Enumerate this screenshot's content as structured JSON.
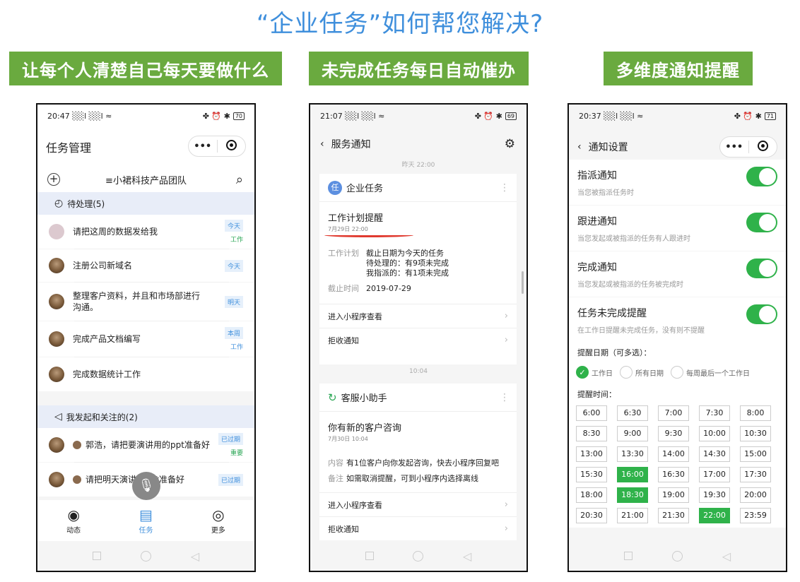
{
  "title": "“企业任务”如何帮您解决?",
  "banners": [
    "让每个人清楚自己每天要做什么",
    "未完成任务每日自动催办",
    "多维度通知提醒"
  ],
  "phone1": {
    "status": {
      "time": "20:47",
      "signal": "░░l ░░l ≈",
      "icons": "✤ ⏰ ✱",
      "battery": "70"
    },
    "nav_title": "任务管理",
    "capsule_more": "•••",
    "team": "≡小裙科技产品团队",
    "pending_header": "待处理(5)",
    "tasks": [
      {
        "text": "请把这周的数据发给我",
        "tag": "今天",
        "type": "工作"
      },
      {
        "text": "注册公司新域名",
        "tag": "今天",
        "type": ""
      },
      {
        "text": "整理客户资料，并且和市场部进行沟通。",
        "tag": "明天",
        "type": ""
      },
      {
        "text": "完成产品文档编写",
        "tag": "本周",
        "type": "工作"
      },
      {
        "text": "完成数据统计工作",
        "tag": "",
        "type": ""
      }
    ],
    "followed_header": "我发起和关注的(2)",
    "followed": [
      {
        "text": "郭浩，请把要演讲用的ppt准备好",
        "tag": "已过期",
        "type": "重要"
      },
      {
        "text": "请把明天演讲的ppt准备好",
        "tag": "已过期",
        "type": ""
      }
    ],
    "tabs": [
      "动态",
      "任务",
      "更多"
    ]
  },
  "phone2": {
    "status": {
      "time": "21:07",
      "signal": "░░l ░░l ≈",
      "icons": "✤ ⏰ ✱",
      "battery": "69"
    },
    "nav_title": "服务通知",
    "ts1": "昨天 22:00",
    "card1": {
      "source": "企业任务",
      "badge": "任",
      "title": "工作计划提醒",
      "date": "7月29日 22:00",
      "plan_key": "工作计划",
      "plan_lines": [
        "截止日期为今天的任务",
        "待处理的：有9项未完成",
        "我指派的：有1项未完成"
      ],
      "due_key": "截止时间",
      "due_val": "2019-07-29",
      "link1": "进入小程序查看",
      "link2": "拒收通知"
    },
    "ts2": "10:04",
    "card2": {
      "source": "客服小助手",
      "title": "你有新的客户咨询",
      "date": "7月30日 10:04",
      "content_key": "内容",
      "content_val": "有1位客户向你发起咨询，快去小程序回复吧",
      "note_key": "备注",
      "note_val": "如需取消提醒，可到小程序内选择离线",
      "link1": "进入小程序查看",
      "link2": "拒收通知"
    }
  },
  "phone3": {
    "status": {
      "time": "20:37",
      "signal": "░░l ░░l ≈",
      "icons": "✤ ⏰ ✱",
      "battery": "71"
    },
    "nav_title": "通知设置",
    "settings": [
      {
        "name": "指派通知",
        "desc": "当您被指派任务时"
      },
      {
        "name": "跟进通知",
        "desc": "当您发起或被指派的任务有人跟进时"
      },
      {
        "name": "完成通知",
        "desc": "当您发起或被指派的任务被完成时"
      },
      {
        "name": "任务未完成提醒",
        "desc": "在工作日提醒未完成任务，没有则不提醒"
      }
    ],
    "date_label": "提醒日期（可多选）：",
    "date_options": [
      "工作日",
      "所有日期",
      "每周最后一个工作日"
    ],
    "time_label": "提醒时间：",
    "times": [
      "6:00",
      "6:30",
      "7:00",
      "7:30",
      "8:00",
      "8:30",
      "9:00",
      "9:30",
      "10:00",
      "10:30",
      "13:00",
      "13:30",
      "14:00",
      "14:30",
      "15:00",
      "15:30",
      "16:00",
      "16:30",
      "17:00",
      "17:30",
      "18:00",
      "18:30",
      "19:00",
      "19:30",
      "20:00",
      "20:30",
      "21:00",
      "21:30",
      "22:00",
      "23:59"
    ],
    "selected_times": [
      "16:00",
      "18:30",
      "22:00"
    ]
  },
  "colors": {
    "accent_blue": "#3f8fdc",
    "banner_green": "#6aaa3f",
    "toggle_green": "#2fb24a",
    "highlight_red": "#e03a2f"
  }
}
